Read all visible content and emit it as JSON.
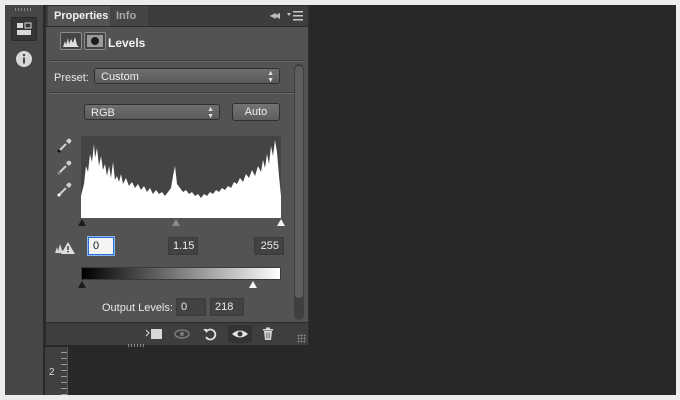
{
  "panel": {
    "tabs": [
      {
        "label": "Properties",
        "active": true
      },
      {
        "label": "Info",
        "active": false
      }
    ],
    "collapse_icon": "double-chevron-left-icon",
    "menu_icon": "panel-menu-icon",
    "header": {
      "title": "Levels",
      "icons": [
        "levels-adjustment-icon",
        "layer-mask-icon"
      ]
    },
    "preset": {
      "label": "Preset:",
      "value": "Custom"
    },
    "channel": {
      "value": "RGB"
    },
    "auto_label": "Auto",
    "eyedroppers": [
      "black-point-eyedropper-icon",
      "gray-point-eyedropper-icon",
      "white-point-eyedropper-icon"
    ],
    "input_levels": {
      "black": "0",
      "midtone": "1.15",
      "white": "255"
    },
    "output_levels": {
      "label": "Output Levels:",
      "black": "0",
      "white": "218"
    },
    "footer_icons": [
      "clip-to-layer-icon",
      "view-previous-state-icon",
      "reset-icon",
      "visibility-eye-icon",
      "delete-icon"
    ],
    "clipping_warning_icon": "clipping-warning-icon"
  },
  "side_strip": {
    "icons": [
      "properties-icon",
      "info-icon"
    ]
  },
  "ruler": {
    "label": "2"
  },
  "colors": {
    "panel_bg": "#535353",
    "tab_bar": "#3d3d3d",
    "canvas_bg": "#282828",
    "input_focus": "#2a6fd6"
  }
}
